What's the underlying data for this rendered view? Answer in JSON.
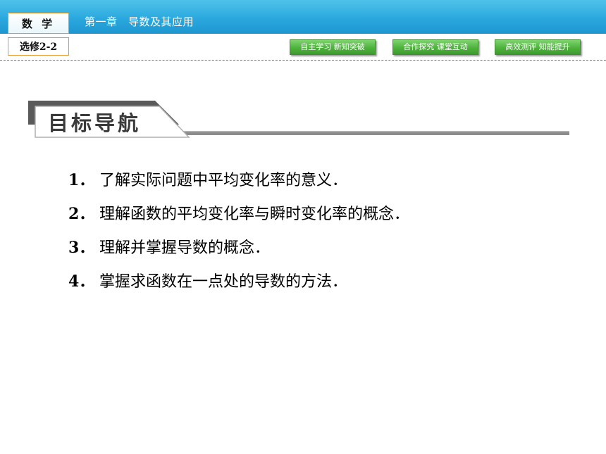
{
  "header": {
    "subject": "数 学",
    "chapter_title": "第一章　导数及其应用",
    "elective": "选修2-2"
  },
  "nav_buttons": [
    {
      "label": "自主学习 新知突破"
    },
    {
      "label": "合作探究 课堂互动"
    },
    {
      "label": "高效测评 知能提升"
    }
  ],
  "section": {
    "title": "目标导航"
  },
  "objectives": [
    {
      "num": "1．",
      "text": "了解实际问题中平均变化率的意义．"
    },
    {
      "num": "2．",
      "text": "理解函数的平均变化率与瞬时变化率的概念．"
    },
    {
      "num": "3．",
      "text": "理解并掌握导数的概念．"
    },
    {
      "num": "4．",
      "text": "掌握求函数在一点处的导数的方法．"
    }
  ],
  "colors": {
    "header_blue": "#2aa8de",
    "box_border": "#e7962f",
    "button_green": "#4eb23d"
  }
}
